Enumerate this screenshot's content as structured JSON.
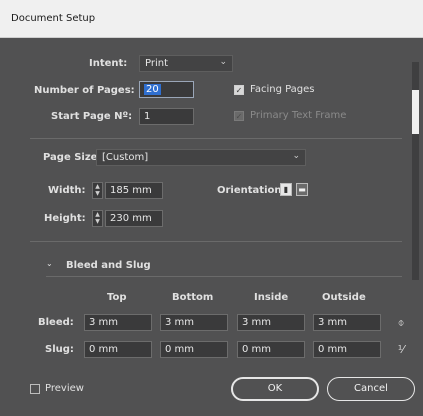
{
  "window": {
    "title": "Document Setup"
  },
  "intent": {
    "label": "Intent:",
    "value": "Print"
  },
  "pages": {
    "label": "Number of Pages:",
    "value": "20",
    "facing_label": "Facing Pages",
    "facing_checked": true
  },
  "start_page": {
    "label": "Start Page Nº:",
    "value": "1",
    "primary_label": "Primary Text Frame",
    "primary_checked": true
  },
  "page_size": {
    "label": "Page Size:",
    "value": "[Custom]"
  },
  "width": {
    "label": "Width:",
    "value": "185 mm"
  },
  "height": {
    "label": "Height:",
    "value": "230 mm"
  },
  "orientation": {
    "label": "Orientation:",
    "active": "portrait"
  },
  "bleed_slug": {
    "heading": "Bleed and Slug",
    "columns": [
      "Top",
      "Bottom",
      "Inside",
      "Outside"
    ],
    "bleed": {
      "label": "Bleed:",
      "values": [
        "3 mm",
        "3 mm",
        "3 mm",
        "3 mm"
      ]
    },
    "slug": {
      "label": "Slug:",
      "values": [
        "0 mm",
        "0 mm",
        "0 mm",
        "0 mm"
      ]
    }
  },
  "preview": {
    "label": "Preview",
    "checked": false
  },
  "buttons": {
    "ok": "OK",
    "cancel": "Cancel"
  },
  "icons": {
    "chevron": "chevron-down-icon",
    "collapse": "collapse-arrow-icon",
    "link": "chain-link-icon",
    "broken_link": "broken-link-icon",
    "portrait": "portrait-orientation-icon",
    "landscape": "landscape-orientation-icon"
  },
  "colors": {
    "selection": "#2f6fd0",
    "panel": "#515152",
    "title_bar": "#f0f0f0"
  }
}
